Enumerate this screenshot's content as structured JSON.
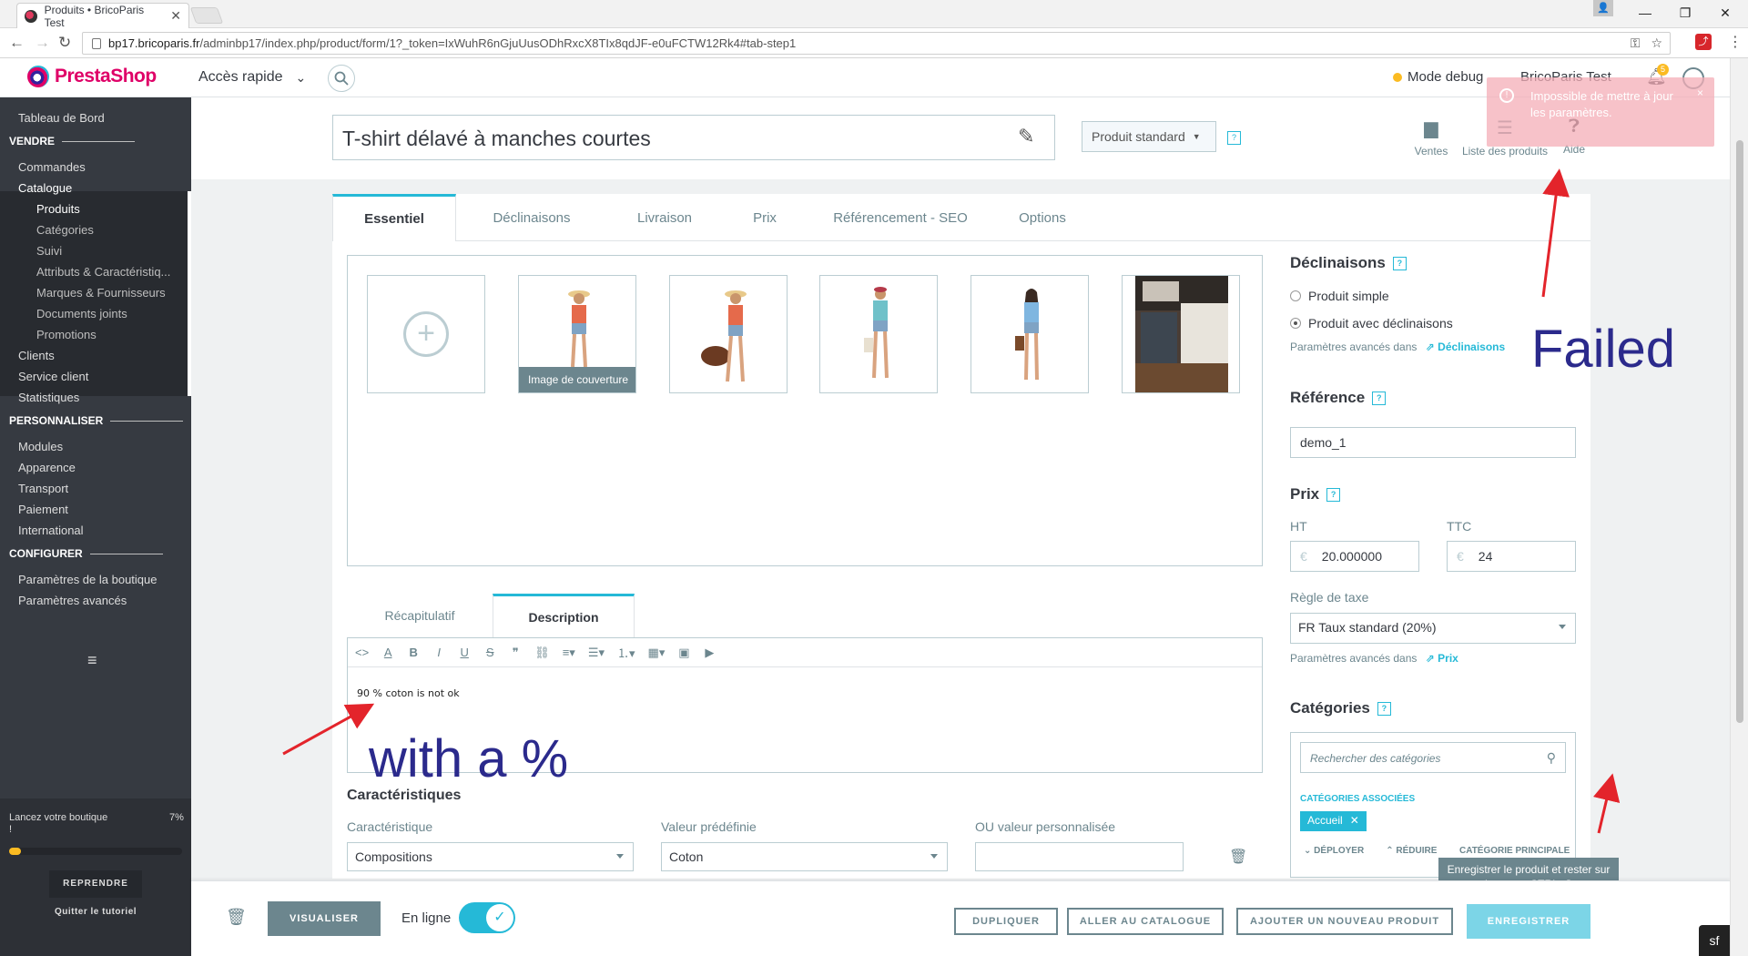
{
  "browser": {
    "tab_title": "Produits • BricoParis Test",
    "tab_close": "✕",
    "url_domain": "bp17.bricoparis.fr",
    "url_path": "/adminbp17/index.php/product/form/1?_token=IxWuhR6nGjuUusODhRxcX8TIx8qdJF-e0uFCTW12Rk4#tab-step1",
    "window_controls": [
      "—",
      "❐",
      "✕"
    ]
  },
  "header": {
    "logo_text": "PrestaShop",
    "quick_access": "Accès rapide",
    "debug_mode": "Mode debug",
    "shop_name": "BricoParis Test",
    "notifications_count": "5"
  },
  "toast": {
    "message": "Impossible de mettre à jour les paramètres.",
    "close": "×"
  },
  "sidebar": {
    "dashboard": "Tableau de Bord",
    "section_sell": "VENDRE",
    "orders": "Commandes",
    "catalog": "Catalogue",
    "catalog_items": [
      "Produits",
      "Catégories",
      "Suivi",
      "Attributs & Caractéristiq...",
      "Marques & Fournisseurs",
      "Documents joints",
      "Promotions"
    ],
    "customers": "Clients",
    "customer_service": "Service client",
    "stats": "Statistiques",
    "section_customize": "PERSONNALISER",
    "modules": "Modules",
    "appearance": "Apparence",
    "shipping": "Transport",
    "payment": "Paiement",
    "international": "International",
    "section_configure": "CONFIGURER",
    "shop_params": "Paramètres de la boutique",
    "advanced_params": "Paramètres avancés",
    "tutorial_label": "Lancez votre boutique",
    "tutorial_pct": "7%",
    "tutorial_progress": 0.07,
    "resume_button": "REPRENDRE",
    "quit_tutorial": "Quitter le tutoriel"
  },
  "product": {
    "name": "T-shirt délavé à manches courtes",
    "type": "Produit standard",
    "help_mark": "?",
    "top_actions": [
      "Ventes",
      "Liste des produits",
      "Aide"
    ]
  },
  "tabs": [
    "Essentiel",
    "Déclinaisons",
    "Livraison",
    "Prix",
    "Référencement - SEO",
    "Options"
  ],
  "images": {
    "cover_label": "Image de couverture",
    "add_symbol": "+"
  },
  "description": {
    "tabs": [
      "Récapitulatif",
      "Description"
    ],
    "text": "90 % coton is not ok"
  },
  "features": {
    "title": "Caractéristiques",
    "col1_label": "Caractéristique",
    "col2_label": "Valeur prédéfinie",
    "col3_label": "OU valeur personnalisée",
    "feature_value": "Compositions",
    "predefined_value": "Coton",
    "custom_value": ""
  },
  "right": {
    "combinations_title": "Déclinaisons",
    "simple_product": "Produit simple",
    "with_combinations": "Produit avec déclinaisons",
    "advanced_in": "Paramètres avancés dans",
    "combinations_link": "Déclinaisons",
    "reference_title": "Référence",
    "reference_value": "demo_1",
    "price_title": "Prix",
    "ht_label": "HT",
    "ttc_label": "TTC",
    "currency": "€",
    "ht_value": "20.000000",
    "ttc_value": "24",
    "tax_rule_label": "Règle de taxe",
    "tax_rule_value": "FR Taux standard (20%)",
    "price_link": "Prix",
    "categories_title": "Catégories",
    "category_search_placeholder": "Rechercher des catégories",
    "associated_label": "CATÉGORIES ASSOCIÉES",
    "category_tag": "Accueil",
    "expand": "DÉPLOYER",
    "collapse": "RÉDUIRE",
    "main_category": "CATÉGORIE PRINCIPALE"
  },
  "footer": {
    "preview": "VISUALISER",
    "online": "En ligne",
    "duplicate": "DUPLIQUER",
    "to_catalog": "ALLER AU CATALOGUE",
    "add_new": "AJOUTER UN NOUVEAU PRODUIT",
    "save": "ENREGISTRER",
    "save_tooltip": "Enregistrer le produit et rester sur la page : CTRL+S"
  },
  "annotations": {
    "failed": "Failed",
    "with_percent": "with a %"
  },
  "colors": {
    "accent": "#25b9d7",
    "sidebar": "#363a41",
    "annotation_arrow": "#e3242b",
    "annotation_text": "#2b2a8c"
  }
}
